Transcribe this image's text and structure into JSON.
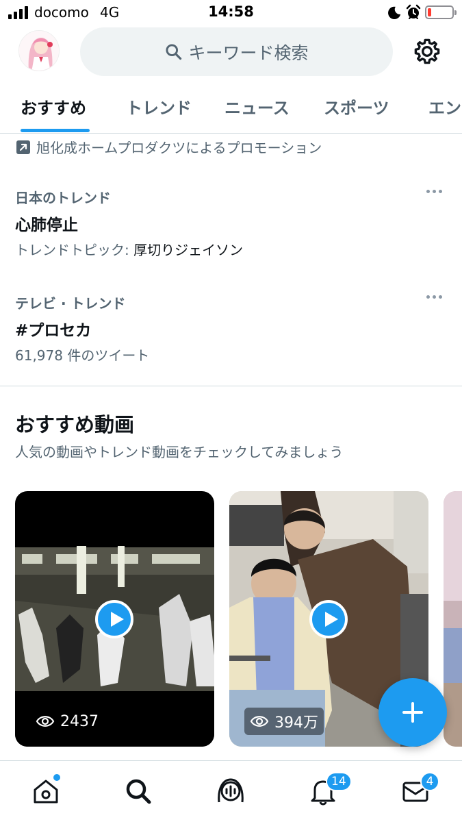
{
  "status_bar": {
    "carrier": "docomo",
    "network": "4G",
    "time": "14:58",
    "battery_level": 0.1,
    "icons": [
      "signal-icon",
      "moon-icon",
      "alarm-icon",
      "battery-icon"
    ]
  },
  "header": {
    "search_placeholder": "キーワード検索",
    "icons": [
      "avatar",
      "search-icon",
      "gear-icon"
    ]
  },
  "tabs": [
    {
      "label": "おすすめ",
      "active": true
    },
    {
      "label": "トレンド",
      "active": false
    },
    {
      "label": "ニュース",
      "active": false
    },
    {
      "label": "スポーツ",
      "active": false
    },
    {
      "label": "エン",
      "active": false
    }
  ],
  "promo": {
    "text": "旭化成ホームプロダクツによるプロモーション",
    "icon": "promoted-icon"
  },
  "trends": [
    {
      "context": "日本のトレンド",
      "title": "心肺停止",
      "meta_prefix": "トレンドトピック: ",
      "meta_value": "厚切りジェイソン"
    },
    {
      "context": "テレビ · トレンド",
      "title": "#プロセカ",
      "meta_prefix": "61,978 件のツイート",
      "meta_value": ""
    }
  ],
  "videos_section": {
    "title": "おすすめ動画",
    "subtitle": "人気の動画やトレンド動画をチェックしてみましょう",
    "cards": [
      {
        "views": "2437"
      },
      {
        "views": "394万"
      }
    ]
  },
  "bottom_nav": {
    "items": [
      "home-icon",
      "search-icon",
      "spaces-icon",
      "notifications-icon",
      "messages-icon"
    ],
    "notifications_badge": "14",
    "messages_badge": "4"
  },
  "colors": {
    "accent": "#1d9bf0",
    "text": "#0f1419",
    "secondary": "#536471",
    "divider": "#cfd9de"
  }
}
